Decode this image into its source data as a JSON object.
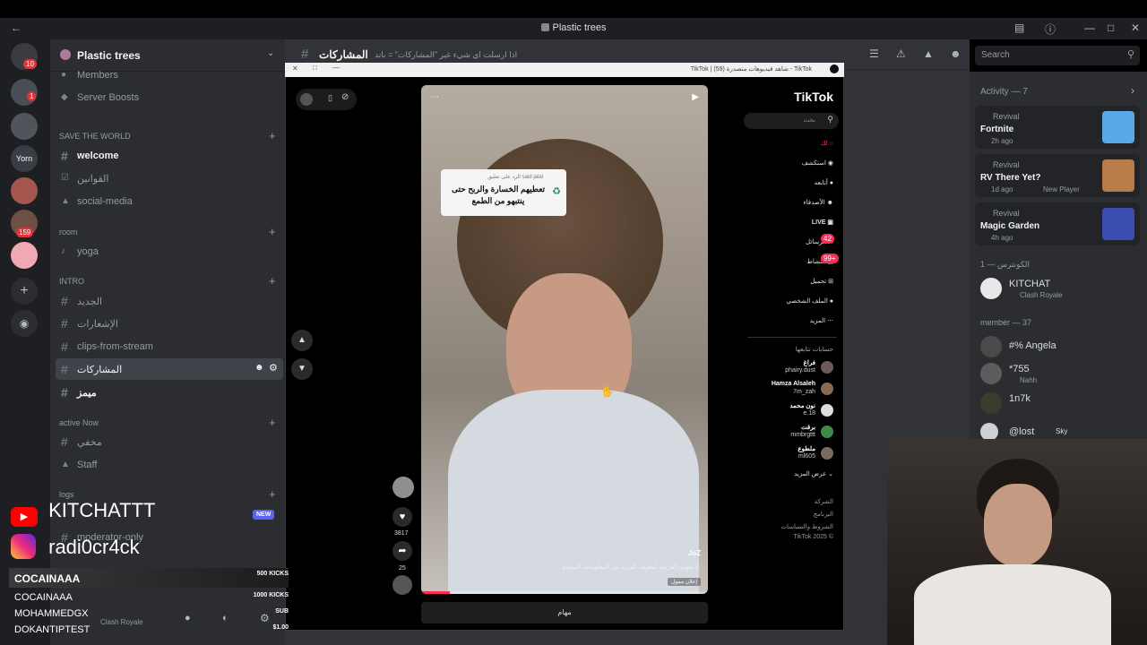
{
  "window": {
    "title": "Plastic trees"
  },
  "server": {
    "name": "Plastic trees",
    "badges": [
      "10",
      "1",
      "159"
    ],
    "server_icon_label": "Yorn"
  },
  "sidebar": {
    "top_items": [
      {
        "label": "Members"
      },
      {
        "label": "Server Boosts"
      }
    ],
    "categories": [
      {
        "name": "SAVE THE WORLD",
        "channels": [
          "welcome",
          "القوانين",
          "social-media"
        ]
      },
      {
        "name": "room",
        "channels": [
          "yoga"
        ]
      },
      {
        "name": "INTRO",
        "channels": [
          "الجديد",
          "الإشعارات",
          "clips-from-stream",
          "المشاركات",
          "ميمز"
        ]
      },
      {
        "name": "active Now",
        "channels": [
          "مخفي",
          "Staff"
        ]
      },
      {
        "name": "logs",
        "channels": [
          "moderator-only"
        ]
      }
    ],
    "new_badge": "NEW",
    "user_status": "Clash Royale"
  },
  "channel_header": {
    "name": "المشاركات",
    "topic": "اذا ارسلت اي شيء غير \"المشاركات\" = باند"
  },
  "search": {
    "placeholder": "Search"
  },
  "activity": {
    "title": "Activity — 7",
    "items": [
      {
        "tag": "Revival",
        "game": "Fortnite",
        "time": "2h ago",
        "extra": ""
      },
      {
        "tag": "Revival",
        "game": "RV There Yet?",
        "time": "1d ago",
        "extra": "New Player"
      },
      {
        "tag": "Revival",
        "game": "Magic Garden",
        "time": "4h ago",
        "extra": ""
      }
    ]
  },
  "member_groups": [
    {
      "title": "الكونترس — 1",
      "members": [
        {
          "name": "KITCHAT",
          "status": "Clash Royale"
        }
      ]
    },
    {
      "title": "member — 37",
      "members": [
        {
          "name": "#% Angela",
          "status": ""
        },
        {
          "name": "*755",
          "status": "Nahh"
        },
        {
          "name": "1n7k",
          "status": ""
        },
        {
          "name": "@lost",
          "status": "Sky"
        }
      ]
    }
  ],
  "tiktok": {
    "window_title": "TikTok | شاهد فيديوهات متصدرة (59) - TikTok",
    "logo": "TikTok",
    "search_placeholder": "بحث",
    "nav": [
      "لك",
      "استكشف",
      "أتابعه",
      "الأصدقاء",
      "LIVE",
      "الرسائل",
      "النشاط",
      "تحميل",
      "الملف الشخصي",
      "المزيد"
    ],
    "nav_badges": [
      "42",
      "99+"
    ],
    "following_title": "حسابات تتابعها",
    "following": [
      {
        "name": "فراغ",
        "handle": "phairy.dust"
      },
      {
        "name": "Hamza Alsaleh",
        "handle": "7m_zah"
      },
      {
        "name": "نون محمد",
        "handle": "e.18"
      },
      {
        "name": "برقت",
        "handle": "mmbrgttt"
      },
      {
        "name": "ملطوع",
        "handle": "ml605"
      }
    ],
    "show_more": "عرض المزيد",
    "footer": [
      "الشركة",
      "البرنامج",
      "الشروط والسياسات",
      "TikTok 2025 ©"
    ],
    "comment_bubble": {
      "reply_to": "الرد على تعليق said jalal",
      "text": "تعطيهم الخسارة والربح حتى ينتبهو من الطمع"
    },
    "likes": "3817",
    "comments": "25",
    "video_author": "JoZ",
    "video_caption": "لا تفوت الفرصة لمعرفة المزيد من المعلومات المفيدة.",
    "sponsored_label": "إعلان ممول",
    "bottom_button": "مهام"
  },
  "overlays": {
    "youtube": "KITCHATTT",
    "instagram": "radi0cr4ck",
    "kicks": [
      {
        "name": "COCAINAAA",
        "amount": "500 KICKS"
      },
      {
        "name": "COCAINAAA",
        "amount": "1000 KICKS"
      },
      {
        "name": "MOHAMMEDGX",
        "amount": "SUB"
      },
      {
        "name": "DOKANTIPTEST",
        "amount": "$1.00"
      }
    ]
  },
  "colors": {
    "discord_bg": "#313338",
    "sidebar_bg": "#2b2d31",
    "rail_bg": "#1e1f22",
    "accent_red": "#da373c",
    "tiktok_pink": "#fe2c55",
    "youtube_red": "#ff0000",
    "new_badge": "#5865f2"
  }
}
